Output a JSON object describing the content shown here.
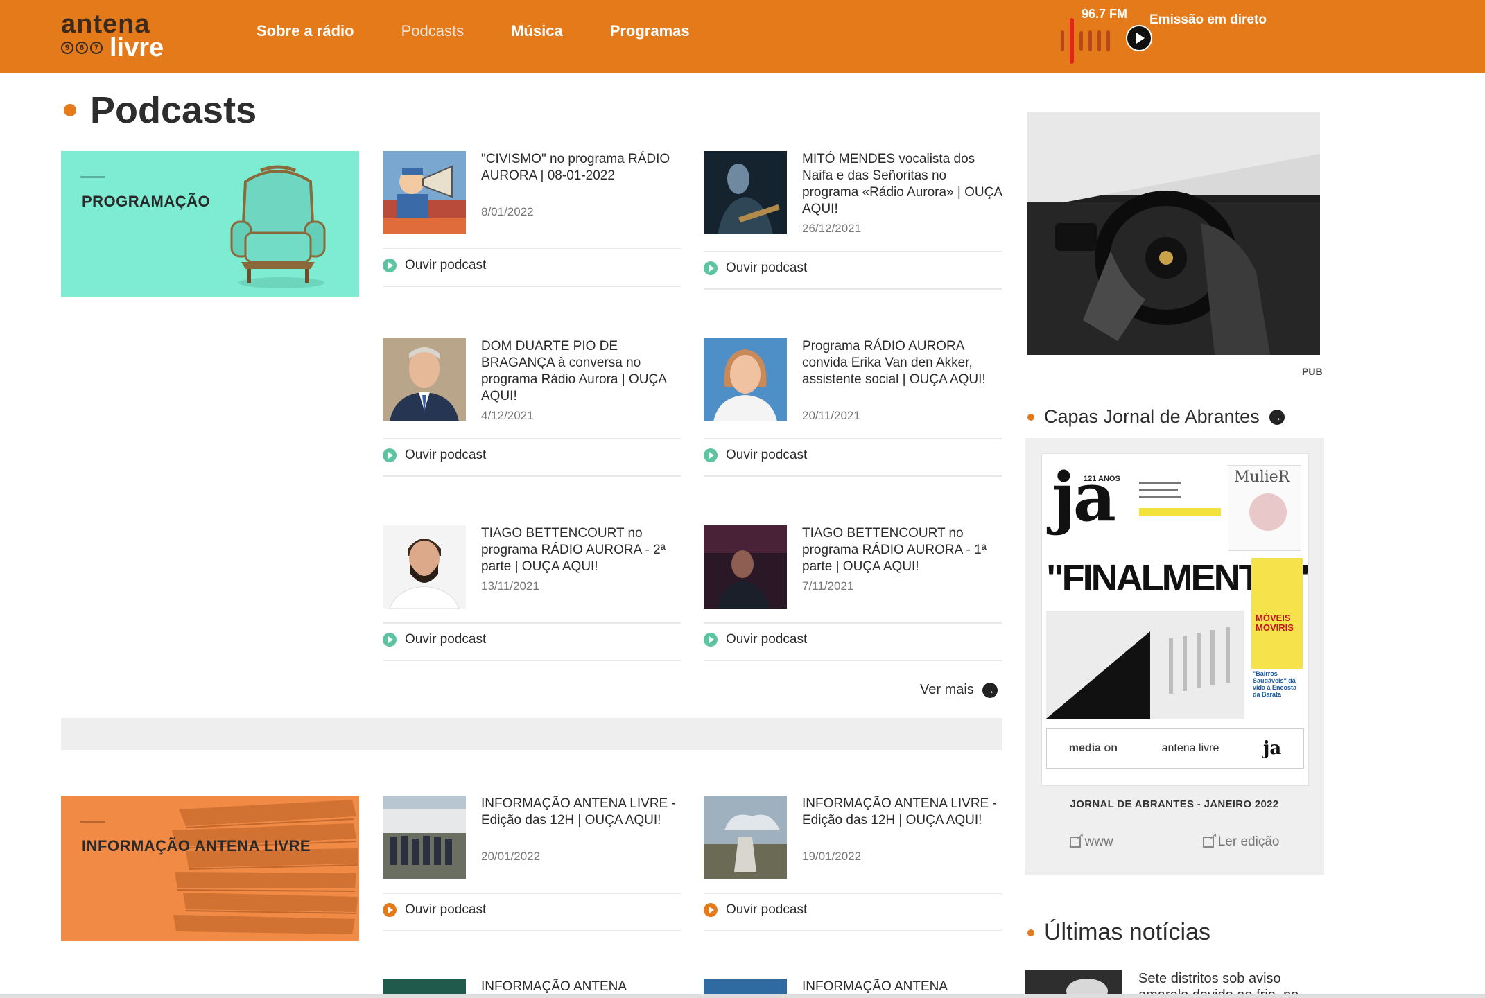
{
  "header": {
    "logo_top": "antena",
    "logo_digits": [
      "9",
      "6",
      "7"
    ],
    "logo_bottom": "livre",
    "nav": [
      "Sobre a rádio",
      "Podcasts",
      "Música",
      "Programas"
    ],
    "live_freq": "96.7 FM",
    "live_label": "Emissão em direto"
  },
  "section_title": "Podcasts",
  "categories": [
    {
      "label": "PROGRAMAÇÃO",
      "color": "#7eecd3"
    },
    {
      "label": "INFORMAÇÃO ANTENA LIVRE",
      "color": "#f08a45"
    }
  ],
  "podcasts": [
    {
      "title": "\"CIVISMO\" no programa RÁDIO AURORA | 08-01-2022",
      "date": "8/01/2022",
      "listen": "Ouvir podcast"
    },
    {
      "title": "MITÓ MENDES vocalista dos Naifa e das Señoritas no programa «Rádio Aurora» | OUÇA AQUI!",
      "date": "26/12/2021",
      "listen": "Ouvir podcast"
    },
    {
      "title": "DOM DUARTE PIO DE BRAGANÇA à conversa no programa Rádio Aurora | OUÇA AQUI!",
      "date": "4/12/2021",
      "listen": "Ouvir podcast"
    },
    {
      "title": "Programa RÁDIO AURORA convida Erika Van den Akker, assistente social | OUÇA AQUI!",
      "date": "20/11/2021",
      "listen": "Ouvir podcast"
    },
    {
      "title": "TIAGO BETTENCOURT no programa RÁDIO AURORA - 2ª parte | OUÇA AQUI!",
      "date": "13/11/2021",
      "listen": "Ouvir podcast"
    },
    {
      "title": "TIAGO BETTENCOURT no programa RÁDIO AURORA - 1ª parte | OUÇA AQUI!",
      "date": "7/11/2021",
      "listen": "Ouvir podcast"
    },
    {
      "title": "INFORMAÇÃO ANTENA LIVRE - Edição das 12H | OUÇA AQUI!",
      "date": "20/01/2022",
      "listen": "Ouvir podcast"
    },
    {
      "title": "INFORMAÇÃO ANTENA LIVRE - Edição das 12H | OUÇA AQUI!",
      "date": "19/01/2022",
      "listen": "Ouvir podcast"
    },
    {
      "title": "INFORMAÇÃO ANTENA"
    },
    {
      "title": "INFORMAÇÃO ANTENA"
    }
  ],
  "ver_mais": "Ver mais",
  "sidebar": {
    "pub": "PUB",
    "jornal_title": "Capas Jornal de Abrantes",
    "jornal_cover": {
      "masthead": "ja",
      "anos": "121 ANOS",
      "headline": "\"FINALMENTE!\"",
      "side_brand": "MulieR",
      "moveis": "MÓVEIS MOVIRIS",
      "bairros": "\"Bairros Saudáveis\" dá vida à Encosta da Barata",
      "footer_brands": [
        "media on",
        "antena livre",
        "ja"
      ]
    },
    "jornal_caption": "JORNAL DE ABRANTES - JANEIRO 2022",
    "jornal_link1": "www",
    "jornal_link2": "Ler edição",
    "news_title": "Últimas notícias",
    "news_first": "Sete distritos sob aviso amarelo devido ao frio, ne"
  }
}
